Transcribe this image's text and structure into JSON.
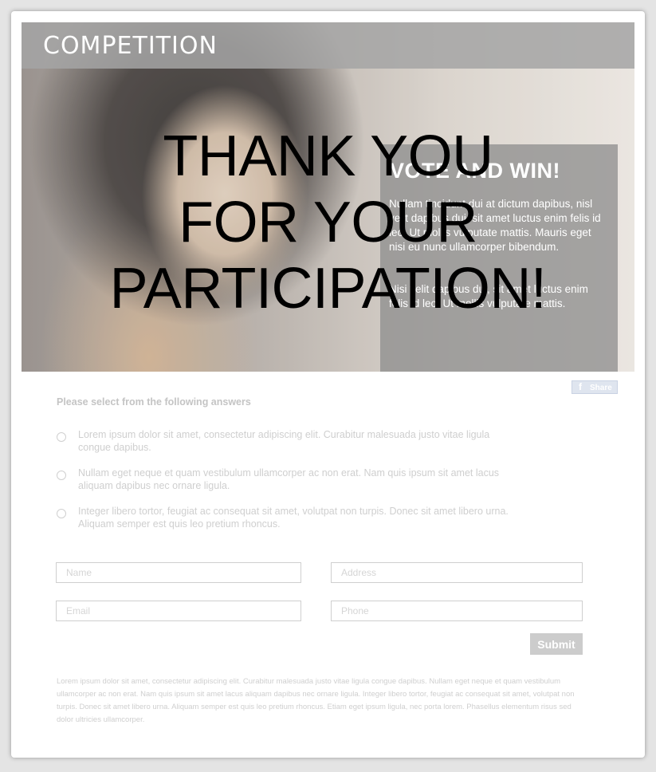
{
  "header": {
    "title": "COMPETITION"
  },
  "promo": {
    "heading": "VOTE AND WIN!",
    "paragraph1": "Nullam tincidunt dui at dictum dapibus, nisl velit dapibus dui, sit amet luctus enim felis id leo. Ut mollis vulputate mattis. Mauris eget nisi eu nunc ullamcorper bibendum.",
    "paragraph2": "Nisi velit dapibus dui, sit amet luctus enim felis id leo. Ut mollis vulputate mattis."
  },
  "share": {
    "label": "Share",
    "icon": "facebook-icon"
  },
  "form": {
    "question": "Please select from the following answers",
    "options": [
      {
        "text": "Lorem ipsum dolor sit amet, consectetur adipiscing elit. Curabitur malesuada justo vitae ligula congue dapibus."
      },
      {
        "text": "Nullam eget neque et quam vestibulum ullamcorper ac non erat. Nam quis ipsum sit amet lacus aliquam dapibus nec ornare ligula."
      },
      {
        "text": "Integer libero tortor, feugiat ac consequat sit amet, volutpat non turpis. Donec sit amet libero urna. Aliquam semper est quis leo pretium rhoncus."
      }
    ],
    "fields": {
      "name": {
        "placeholder": "Name",
        "value": ""
      },
      "address": {
        "placeholder": "Address",
        "value": ""
      },
      "email": {
        "placeholder": "Email",
        "value": ""
      },
      "phone": {
        "placeholder": "Phone",
        "value": ""
      }
    },
    "submit_label": "Submit"
  },
  "fine_print": "Lorem ipsum dolor sit amet, consectetur adipiscing elit. Curabitur malesuada justo vitae ligula congue dapibus. Nullam eget neque et quam vestibulum ullamcorper ac non erat. Nam quis ipsum sit amet lacus aliquam dapibus nec ornare ligula. Integer libero tortor, feugiat ac consequat sit amet, volutpat non turpis. Donec sit amet libero urna. Aliquam semper est quis leo pretium rhoncus. Etiam eget ipsum ligula, nec porta lorem. Phasellus elementum risus sed dolor ultricies ullamcorper.",
  "overlay": {
    "lines": [
      "THANK YOU",
      "FOR YOUR",
      "PARTICIPATION!"
    ]
  },
  "colors": {
    "title_bar": "#a5a5a5",
    "submit_bg": "#cccccc",
    "overlay_text": "#000000"
  }
}
